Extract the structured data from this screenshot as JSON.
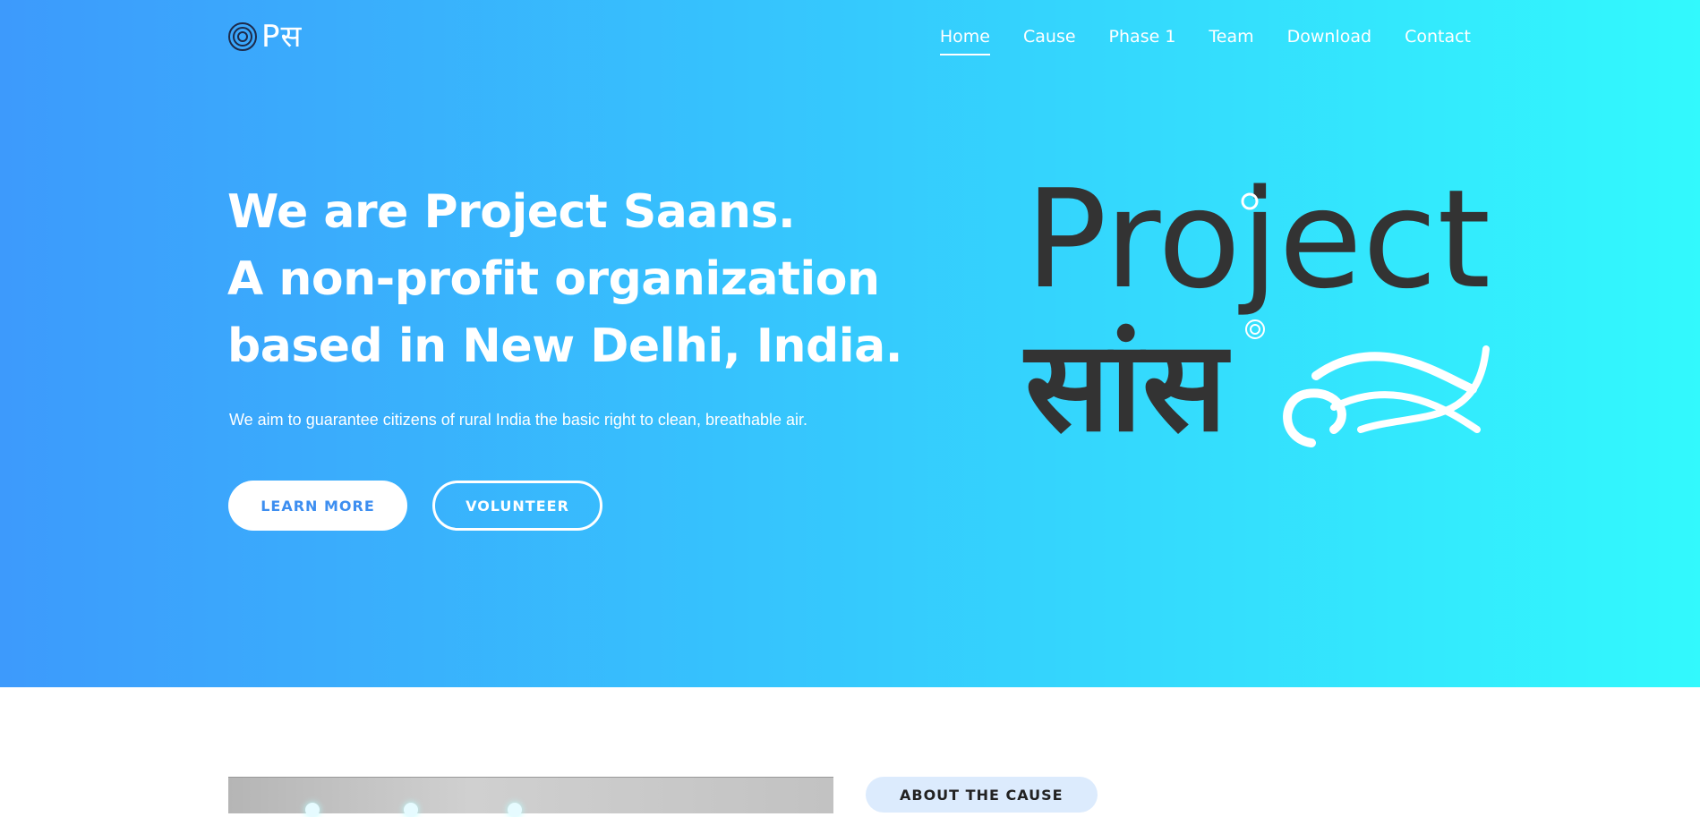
{
  "logo": {
    "text": "Pस",
    "icon": "concentric-circles-icon"
  },
  "nav": {
    "items": [
      "Home",
      "Cause",
      "Phase 1",
      "Team",
      "Download",
      "Contact"
    ],
    "active": "Home"
  },
  "hero": {
    "headline": [
      "We are Project Saans.",
      "A non-profit organization",
      "based in New Delhi, India."
    ],
    "subtitle": "We aim to guarantee citizens of rural India the basic right to clean, breathable air.",
    "buttons": {
      "learn_more": "LEARN MORE",
      "volunteer": "VOLUNTEER"
    },
    "brand": {
      "line1": "Project",
      "line2": "सांस"
    }
  },
  "about": {
    "badge": "ABOUT THE CAUSE"
  },
  "colors": {
    "gradient_start": "#3d9afc",
    "gradient_end": "#32f9fd",
    "brand_text": "#333333",
    "accent": "#3d8ef0"
  }
}
